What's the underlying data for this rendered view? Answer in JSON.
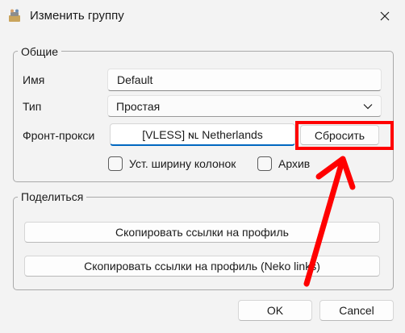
{
  "window": {
    "title": "Изменить группу",
    "icon": "app-icon",
    "close_icon": "close-icon"
  },
  "general": {
    "legend": "Общие",
    "name_label": "Имя",
    "name_value": "Default",
    "type_label": "Тип",
    "type_value": "Простая",
    "front_proxy_label": "Фронт-прокси",
    "front_proxy_value": "[VLESS] ɴʟ Netherlands",
    "reset_label": "Сбросить",
    "column_width_label": "Уст. ширину колонок",
    "archive_label": "Архив",
    "column_width_checked": false,
    "archive_checked": false
  },
  "share": {
    "legend": "Поделиться",
    "copy_links_label": "Скопировать ссылки на профиль",
    "copy_neko_links_label": "Скопировать ссылки на профиль (Neko links)"
  },
  "footer": {
    "ok_label": "OK",
    "cancel_label": "Cancel"
  },
  "annotation": {
    "color": "#ff0000"
  }
}
